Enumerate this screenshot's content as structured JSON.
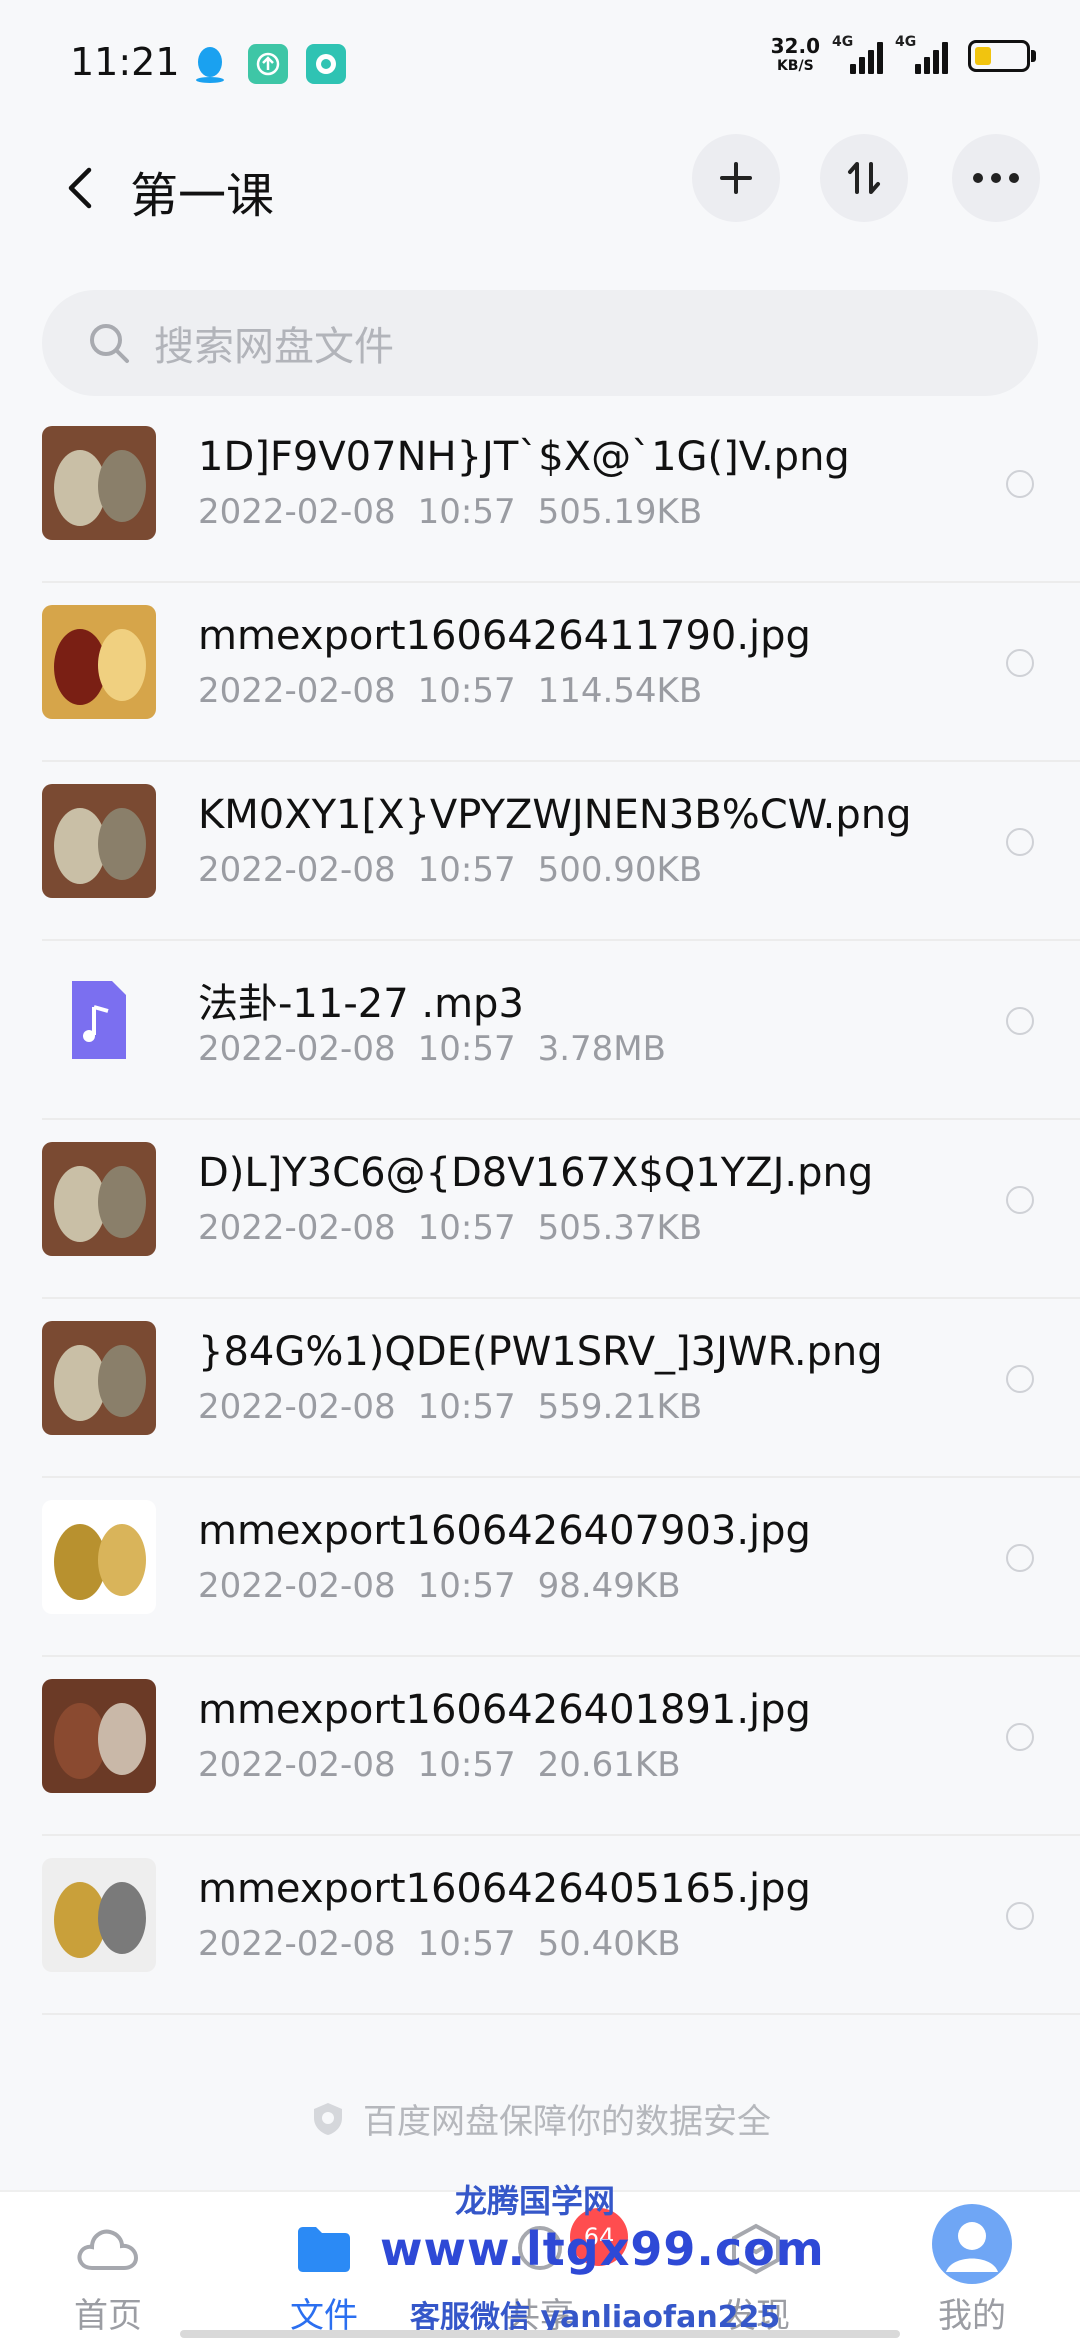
{
  "status_bar": {
    "time": "11:21",
    "net_speed_value": "32.0",
    "net_speed_unit": "KB/S",
    "signal1_label": "4G",
    "signal2_label": "4G"
  },
  "header": {
    "title": "第一课"
  },
  "search": {
    "placeholder": "搜索网盘文件"
  },
  "files": [
    {
      "name": "1D]F9V07NH}JT`$X@`1G(]V.png",
      "date": "2022-02-08",
      "time": "10:57",
      "size": "505.19KB",
      "thumb": "photo-carved-bead"
    },
    {
      "name": "mmexport1606426411790.jpg",
      "date": "2022-02-08",
      "time": "10:57",
      "size": "114.54KB",
      "thumb": "photo-red-carving"
    },
    {
      "name": "KM0XY1[X}VPYZWJNEN3B%CW.png",
      "date": "2022-02-08",
      "time": "10:57",
      "size": "500.90KB",
      "thumb": "photo-carved-bead"
    },
    {
      "name": "法卦-11-27 .mp3",
      "date": "2022-02-08",
      "time": "10:57",
      "size": "3.78MB",
      "thumb": "music-file-icon"
    },
    {
      "name": "D)L]Y3C6@{D8V167X$Q1YZJ.png",
      "date": "2022-02-08",
      "time": "10:57",
      "size": "505.37KB",
      "thumb": "photo-carved-bead"
    },
    {
      "name": "}84G%1)QDE(PW1SRV_]3JWR.png",
      "date": "2022-02-08",
      "time": "10:57",
      "size": "559.21KB",
      "thumb": "photo-carved-bead"
    },
    {
      "name": "mmexport1606426407903.jpg",
      "date": "2022-02-08",
      "time": "10:57",
      "size": "98.49KB",
      "thumb": "photo-gold-beads"
    },
    {
      "name": "mmexport1606426401891.jpg",
      "date": "2022-02-08",
      "time": "10:57",
      "size": "20.61KB",
      "thumb": "photo-wood-carving"
    },
    {
      "name": "mmexport1606426405165.jpg",
      "date": "2022-02-08",
      "time": "10:57",
      "size": "50.40KB",
      "thumb": "photo-gold-pendant"
    }
  ],
  "footer_note": "百度网盘保障你的数据安全",
  "tabs": [
    {
      "label": "首页",
      "icon": "cloud-icon",
      "active": false
    },
    {
      "label": "文件",
      "icon": "folder-icon",
      "active": true
    },
    {
      "label": "共享",
      "icon": "share-icon",
      "active": false
    },
    {
      "label": "发现",
      "icon": "discover-icon",
      "active": false
    },
    {
      "label": "我的",
      "icon": "avatar-icon",
      "active": false
    }
  ],
  "badge_count": "64",
  "watermark": {
    "line1": "龙腾国学网",
    "line2": "www.ltgx99.com",
    "line3": "客服微信 yanliaofan225"
  },
  "colors": {
    "accent": "#2b6ff0",
    "badge": "#ff4d4f",
    "music_icon": "#7b6ff0"
  }
}
